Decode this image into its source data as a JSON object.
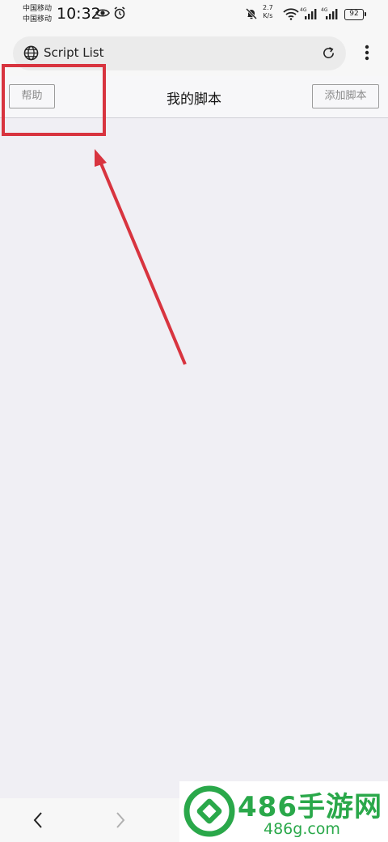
{
  "status_bar": {
    "carrier_1": "中国移动",
    "carrier_2": "中国移动",
    "time": "10:32",
    "net_speed_value": "2.7",
    "net_speed_unit": "K/s",
    "signal_1_label": "4G",
    "signal_2_label": "4G",
    "battery": "92",
    "icons": [
      "eye-icon",
      "alarm-icon",
      "mute-bell-icon",
      "wifi-icon",
      "signal-icon",
      "signal-icon",
      "battery-icon"
    ]
  },
  "browser": {
    "url_text": "Script List",
    "icons": [
      "globe-icon",
      "reload-icon",
      "more-vert-icon"
    ]
  },
  "app_header": {
    "help_button": "帮助",
    "title": "我的脚本",
    "add_button": "添加脚本"
  },
  "annotation": {
    "color": "#d8343f"
  },
  "bottom_nav": {
    "icons": [
      "back-icon",
      "forward-icon"
    ]
  },
  "watermark": {
    "brand": "486手游网",
    "domain": "486g.com",
    "color": "#2aa84a"
  }
}
